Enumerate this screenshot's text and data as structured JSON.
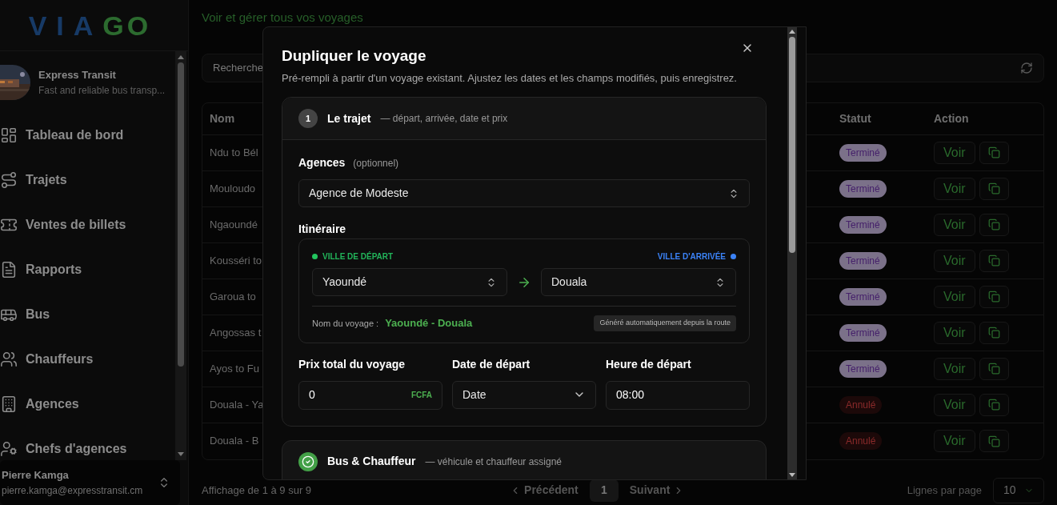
{
  "sidebar": {
    "logo": {
      "part_1": "VIA",
      "part_2": "GO"
    },
    "company": {
      "name": "Express Transit",
      "tagline": "Fast and reliable bus transp..."
    },
    "nav": [
      {
        "label": "Tableau de bord"
      },
      {
        "label": "Trajets"
      },
      {
        "label": "Ventes de billets"
      },
      {
        "label": "Rapports"
      },
      {
        "label": "Bus"
      },
      {
        "label": "Chauffeurs"
      },
      {
        "label": "Agences"
      },
      {
        "label": "Chefs d'agences"
      }
    ],
    "user": {
      "name": "Pierre Kamga",
      "email": "pierre.kamga@expresstransit.cm"
    }
  },
  "main": {
    "subtitle": "Voir et gérer tous vos voyages",
    "search": {
      "placeholder": "Recherche"
    },
    "table": {
      "columns": [
        "Nom",
        "Statut",
        "Action"
      ],
      "rows": [
        {
          "name": "Ndu to Bél",
          "status": {
            "label": "Terminé",
            "kind": "done"
          },
          "view": "Voir"
        },
        {
          "name": "Mouloudo",
          "status": {
            "label": "Terminé",
            "kind": "done"
          },
          "view": "Voir"
        },
        {
          "name": "Ngaoundé",
          "status": {
            "label": "Terminé",
            "kind": "done"
          },
          "view": "Voir"
        },
        {
          "name": "Kousséri to",
          "status": {
            "label": "Terminé",
            "kind": "done"
          },
          "view": "Voir"
        },
        {
          "name": "Garoua to",
          "status": {
            "label": "Terminé",
            "kind": "done"
          },
          "view": "Voir"
        },
        {
          "name": "Angossas t",
          "status": {
            "label": "Terminé",
            "kind": "done"
          },
          "view": "Voir"
        },
        {
          "name": "Ayos to Fu",
          "status": {
            "label": "Terminé",
            "kind": "done"
          },
          "view": "Voir"
        },
        {
          "name": "Douala - Ya",
          "status": {
            "label": "Annulé",
            "kind": "cancelled"
          },
          "view": "Voir"
        },
        {
          "name": "Douala - B",
          "status": {
            "label": "Annulé",
            "kind": "cancelled"
          },
          "view": "Voir"
        }
      ]
    },
    "footer": {
      "summary": "Affichage de 1 à 9 sur 9",
      "previous": "Précédent",
      "page": "1",
      "next": "Suivant",
      "rows_label": "Lignes par page",
      "rows_value": "10"
    }
  },
  "modal": {
    "title": "Dupliquer le voyage",
    "description": "Pré-rempli à partir d'un voyage existant. Ajustez les dates et les champs modifiés, puis enregistrez.",
    "sections": [
      {
        "kind": "number",
        "badge": "1",
        "title": "Le trajet",
        "subtitle": "— départ, arrivée, date et prix"
      },
      {
        "kind": "done",
        "title": "Bus & Chauffeur",
        "subtitle": "— véhicule et chauffeur assigné"
      }
    ],
    "trip": {
      "agency_label": "Agences",
      "agency_hint": "(optionnel)",
      "agency_value": "Agence de Modeste",
      "route_label": "Itinéraire",
      "departure_label": "VILLE DE DÉPART",
      "arrival_label": "VILLE D'ARRIVÉE",
      "departure_value": "Yaoundé",
      "arrival_value": "Douala",
      "name_label": "Nom du voyage :",
      "name_value": "Yaoundé - Douala",
      "auto_note": "Généré automatiquement depuis la route",
      "price_label": "Prix total du voyage",
      "price_value": "0",
      "currency": "FCFA",
      "date_label": "Date de départ",
      "date_value": "Date",
      "time_label": "Heure de départ",
      "time_value": "08:00"
    }
  }
}
